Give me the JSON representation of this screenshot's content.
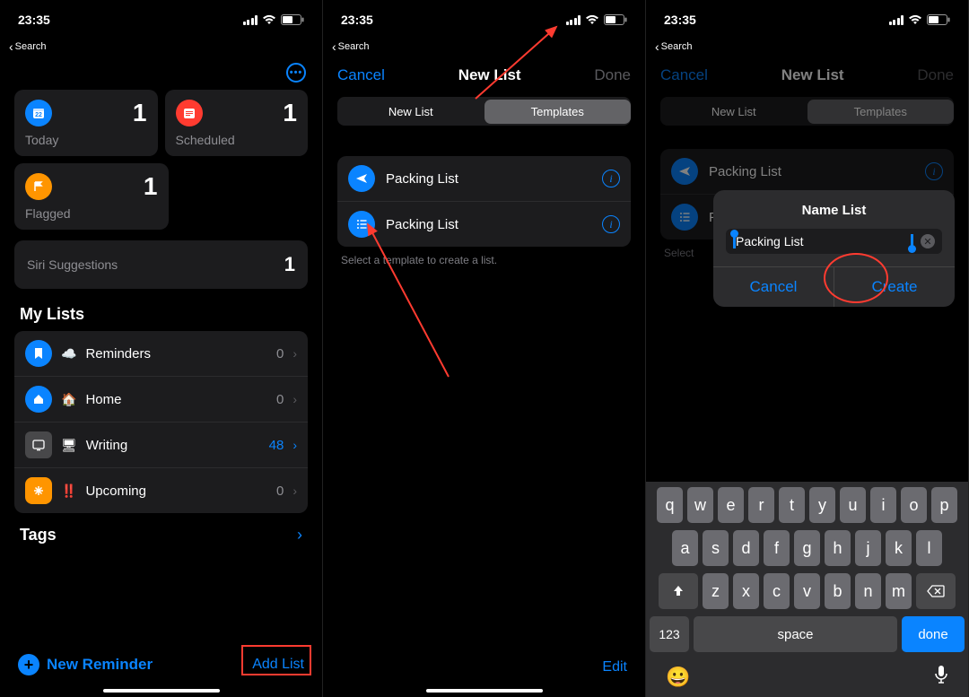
{
  "status": {
    "time": "23:35",
    "back_label": "Search"
  },
  "screen1": {
    "cards": {
      "today": {
        "label": "Today",
        "count": "1"
      },
      "scheduled": {
        "label": "Scheduled",
        "count": "1"
      },
      "flagged": {
        "label": "Flagged",
        "count": "1"
      }
    },
    "siri": {
      "label": "Siri Suggestions",
      "count": "1"
    },
    "mylists_title": "My Lists",
    "lists": [
      {
        "emoji": "☁️",
        "name": "Reminders",
        "count": "0",
        "accent": false
      },
      {
        "emoji": "🏠",
        "name": "Home",
        "count": "0",
        "accent": false
      },
      {
        "emoji": "🖥",
        "name": "Writing",
        "count": "48",
        "accent": true
      },
      {
        "emoji": "‼️",
        "name": "Upcoming",
        "count": "0",
        "accent": false
      }
    ],
    "tags_title": "Tags",
    "new_reminder": "New Reminder",
    "add_list": "Add List"
  },
  "screen2": {
    "nav": {
      "cancel": "Cancel",
      "title": "New List",
      "done": "Done"
    },
    "segments": {
      "new_list": "New List",
      "templates": "Templates"
    },
    "templates": [
      {
        "name": "Packing List",
        "icon": "plane"
      },
      {
        "name": "Packing List",
        "icon": "list"
      }
    ],
    "hint": "Select a template to create a list.",
    "edit": "Edit"
  },
  "screen3": {
    "nav": {
      "cancel": "Cancel",
      "title": "New List",
      "done": "Done"
    },
    "segments": {
      "new_list": "New List",
      "templates": "Templates"
    },
    "templates": [
      {
        "name": "Packing List",
        "icon": "plane"
      },
      {
        "name": "Packing List",
        "icon": "list"
      }
    ],
    "hint_short": "Select",
    "popup": {
      "title": "Name List",
      "value": "Packing List",
      "cancel": "Cancel",
      "create": "Create"
    },
    "keyboard": {
      "row1": [
        "q",
        "w",
        "e",
        "r",
        "t",
        "y",
        "u",
        "i",
        "o",
        "p"
      ],
      "row2": [
        "a",
        "s",
        "d",
        "f",
        "g",
        "h",
        "j",
        "k",
        "l"
      ],
      "row3": [
        "z",
        "x",
        "c",
        "v",
        "b",
        "n",
        "m"
      ],
      "num": "123",
      "space": "space",
      "done": "done"
    }
  }
}
